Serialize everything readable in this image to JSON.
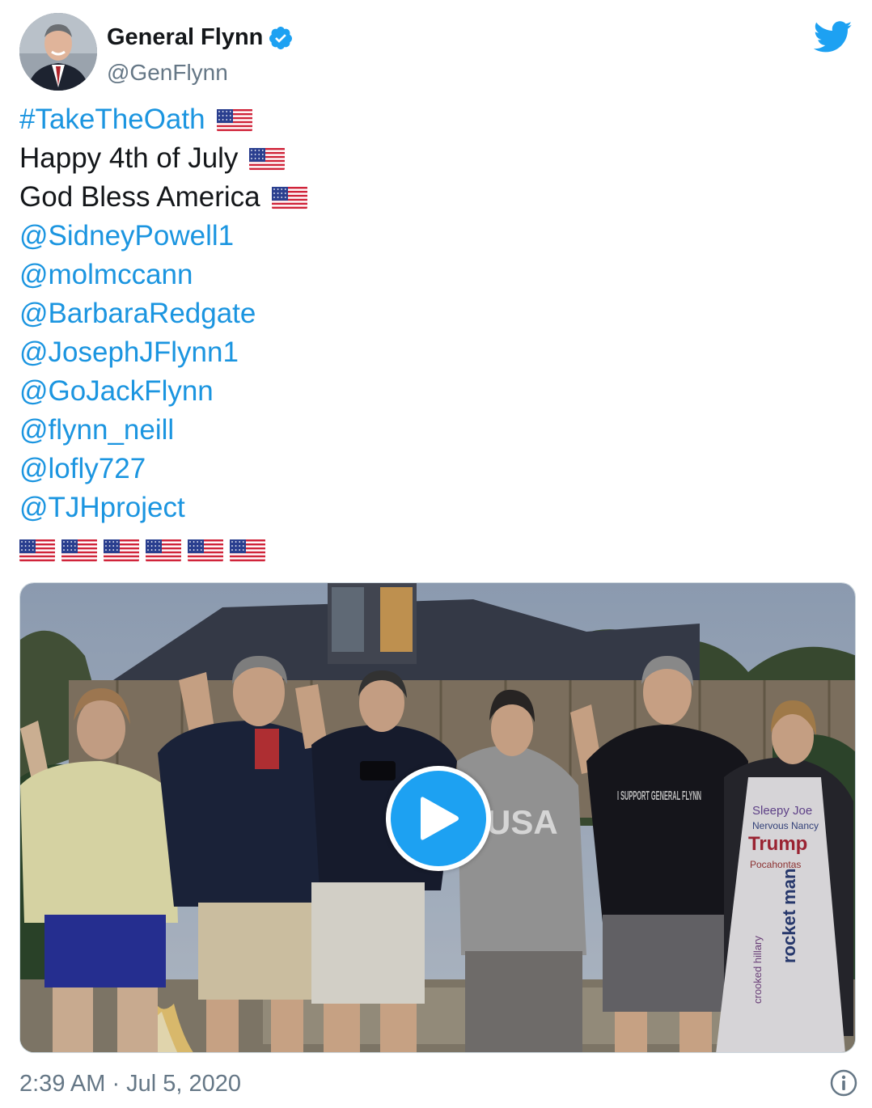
{
  "author": {
    "name": "General Flynn",
    "handle": "@GenFlynn",
    "verified": true
  },
  "tweet": {
    "hashtag": "#TakeTheOath",
    "line2": "Happy 4th of July",
    "line3": "God Bless America",
    "mentions": [
      "@SidneyPowell1",
      "@molmccann",
      "@BarbaraRedgate",
      "@JosephJFlynn1",
      "@GoJackFlynn",
      "@flynn_neill",
      "@lofly727",
      "@TJHproject"
    ],
    "flag_count": 6
  },
  "media": {
    "type": "video",
    "shirt_text_usa": "USA",
    "shirt_text_support": "I SUPPORT GENERAL FLYNN",
    "dress_words": [
      "Sleepy Joe",
      "Nervous Nancy",
      "Trump",
      "Pocahontas",
      "rocket man",
      "crooked hillary"
    ]
  },
  "footer": {
    "timestamp": "2:39 AM · Jul 5, 2020"
  },
  "colors": {
    "link": "#1b95e0",
    "twitter_blue": "#1da1f2",
    "muted": "#657786"
  },
  "icons": [
    "verified-badge-icon",
    "twitter-bird-icon",
    "us-flag-icon",
    "play-icon",
    "info-icon"
  ]
}
